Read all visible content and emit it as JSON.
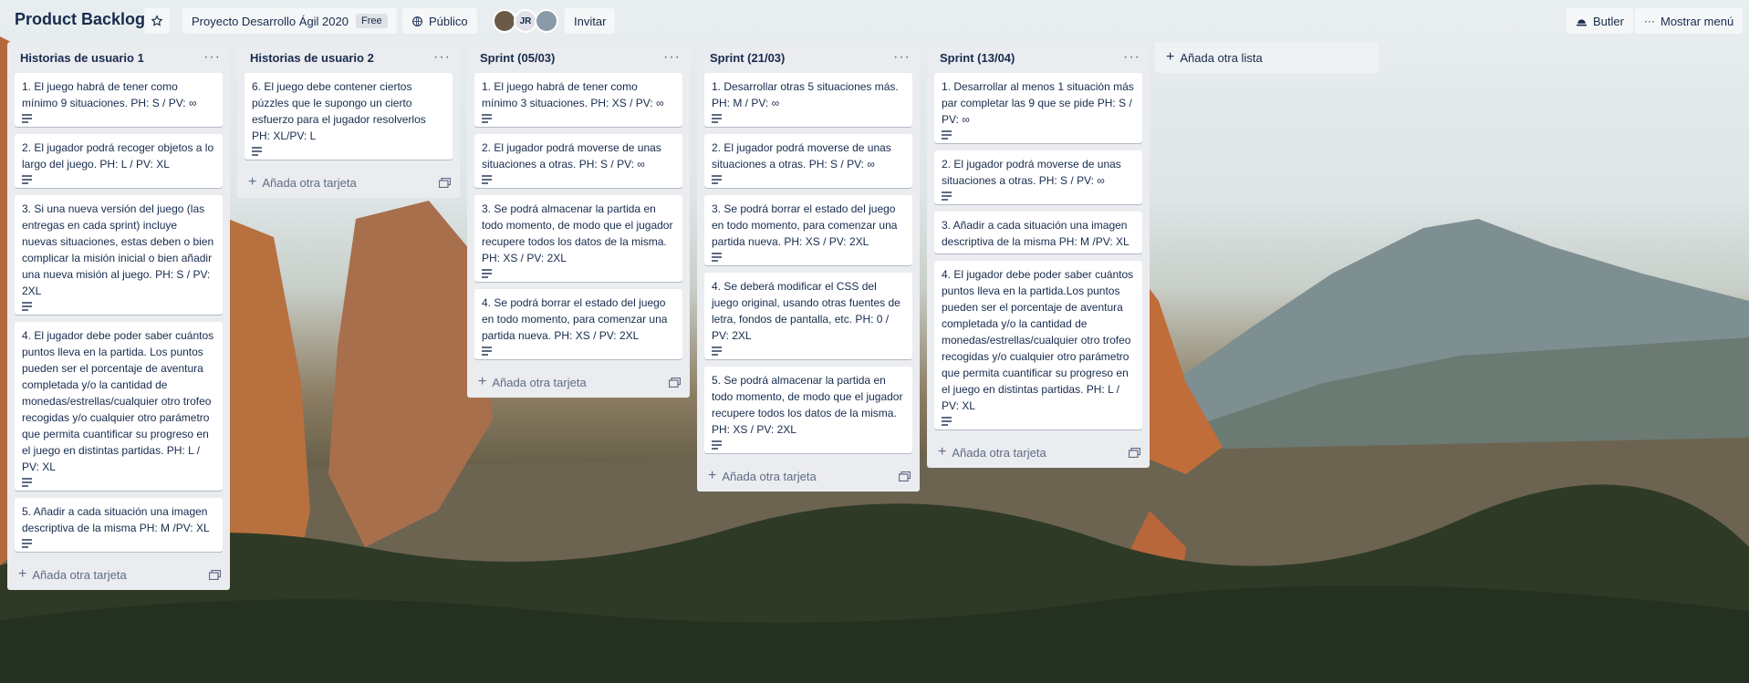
{
  "board": {
    "title": "Product Backlog",
    "workspace_name": "Proyecto Desarrollo Ágil 2020",
    "workspace_badge": "Free",
    "visibility": "Público",
    "members": [
      "JR"
    ],
    "invite_label": "Invitar",
    "butler_label": "Butler",
    "show_menu_label": "Mostrar menú",
    "add_list_label": "Añada otra lista",
    "star_icon": "star-icon"
  },
  "lists": [
    {
      "title": "Historias de usuario 1",
      "add_card_label": "Añada otra tarjeta",
      "cards": [
        "1. El juego habrá de tener como mínimo 9 situaciones. PH: S / PV: ∞",
        "2. El jugador podrá recoger objetos a lo largo del juego. PH: L / PV: XL",
        "3. Si una nueva versión del juego (las entregas en cada sprint) incluye nuevas situaciones, estas deben o bien complicar la misión inicial o bien añadir una nueva misión al juego. PH: S / PV: 2XL",
        "4. El jugador debe poder saber cuántos puntos lleva en la partida. Los puntos pueden ser el porcentaje de aventura completada y/o la cantidad de monedas/estrellas/cualquier otro trofeo recogidas y/o cualquier otro parámetro que permita cuantificar su progreso en el juego en distintas partidas. PH: L / PV: XL",
        "5. Añadir a cada situación una imagen descriptiva de la misma PH: M /PV: XL"
      ]
    },
    {
      "title": "Historias de usuario 2",
      "add_card_label": "Añada otra tarjeta",
      "cards": [
        "6. El juego debe contener ciertos púzzles que le supongo un cierto esfuerzo para el jugador resolverlos PH: XL/PV: L"
      ]
    },
    {
      "title": "Sprint (05/03)",
      "add_card_label": "Añada otra tarjeta",
      "cards": [
        "1. El juego habrá de tener como mínimo 3 situaciones. PH: XS / PV: ∞",
        "2. El jugador podrá moverse de unas situaciones a otras. PH: S / PV: ∞",
        "3. Se podrá almacenar la partida en todo momento, de modo que el jugador recupere todos los datos de la misma. PH: XS / PV: 2XL",
        "4. Se podrá borrar el estado del juego en todo momento, para comenzar una partida nueva. PH: XS / PV: 2XL"
      ]
    },
    {
      "title": "Sprint (21/03)",
      "add_card_label": "Añada otra tarjeta",
      "cards": [
        "1. Desarrollar otras 5 situaciones más. PH: M / PV: ∞",
        "2. El jugador podrá moverse de unas situaciones a otras. PH: S / PV: ∞",
        "3. Se podrá borrar el estado del juego en todo momento, para comenzar una partida nueva. PH: XS / PV: 2XL",
        "4. Se deberá modificar el CSS del juego original, usando otras fuentes de letra, fondos de pantalla, etc. PH: 0 / PV: 2XL",
        "5. Se podrá almacenar la partida en todo momento, de modo que el jugador recupere todos los datos de la misma. PH: XS / PV: 2XL"
      ]
    },
    {
      "title": "Sprint (13/04)",
      "add_card_label": "Añada otra tarjeta",
      "cards": [
        "1. Desarrollar al menos 1 situación más par completar las 9 que se pide PH: S / PV: ∞",
        "2. El jugador podrá moverse de unas situaciones a otras. PH: S / PV: ∞",
        "3. Añadir a cada situación una imagen descriptiva de la misma PH: M /PV: XL",
        "4. El jugador debe poder saber cuántos puntos lleva en la partida.Los puntos pueden ser el porcentaje de aventura completada y/o la cantidad de monedas/estrellas/cualquier otro trofeo recogidas y/o cualquier otro parámetro que permita cuantificar su progreso en el juego en distintas partidas. PH: L / PV: XL"
      ]
    }
  ]
}
